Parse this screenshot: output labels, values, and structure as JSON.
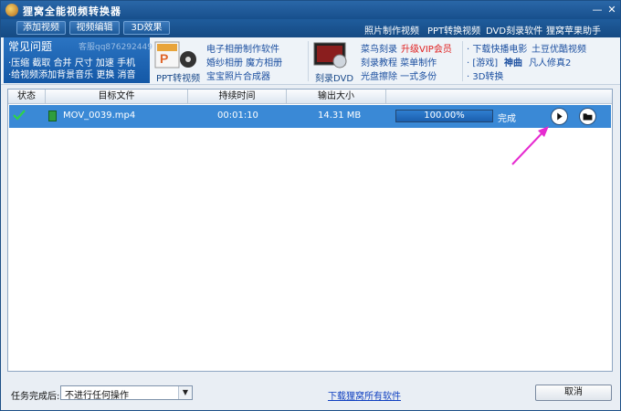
{
  "window": {
    "title": "狸窝全能视频转换器"
  },
  "toolbar": {
    "buttons": [
      "添加视频",
      "视频编辑",
      "3D效果"
    ],
    "links": [
      "照片制作视频",
      "PPT转换视频",
      "DVD刻录软件",
      "狸窝苹果助手"
    ]
  },
  "banner": {
    "faq": {
      "title": "常见问题",
      "qq": "客服qq876292449",
      "line1": "·压缩 截取 合并 尺寸 加速 手机",
      "line2": "·给视频添加背景音乐 更换 消音"
    },
    "ppt_label": "PPT转视频",
    "ppt_links": [
      "电子相册制作软件",
      "婚纱相册 魔方相册",
      "宝宝照片合成器"
    ],
    "dvd_label": "刻录DVD",
    "dvd_links": {
      "a1": "菜鸟刻录",
      "a2": "升级VIP会员",
      "b": "刻录教程 菜单制作",
      "c": "光盘擦除 一式多份"
    },
    "right_links": {
      "r1a": "· 下载快播电影",
      "r1b": "土豆优酷视频",
      "r2a": "· [游戏]",
      "r2b": "神曲",
      "r2c": "凡人修真2",
      "r3": "· 3D转换"
    }
  },
  "table": {
    "headers": [
      "状态",
      "目标文件",
      "持续时间",
      "输出大小"
    ],
    "rows": [
      {
        "file": "MOV_0039.mp4",
        "duration": "00:01:10",
        "size": "14.31 MB",
        "progress": 1.0,
        "progress_text": "100.00%",
        "state": "完成"
      }
    ]
  },
  "footer": {
    "after_label": "任务完成后:",
    "after_value": "不进行任何操作",
    "download_link": "下载狸窝所有软件",
    "cancel": "取消"
  },
  "colors": {
    "titlebar": "#1f5c9c",
    "row_highlight": "#3a89d6",
    "annotation": "#e62bd0"
  }
}
